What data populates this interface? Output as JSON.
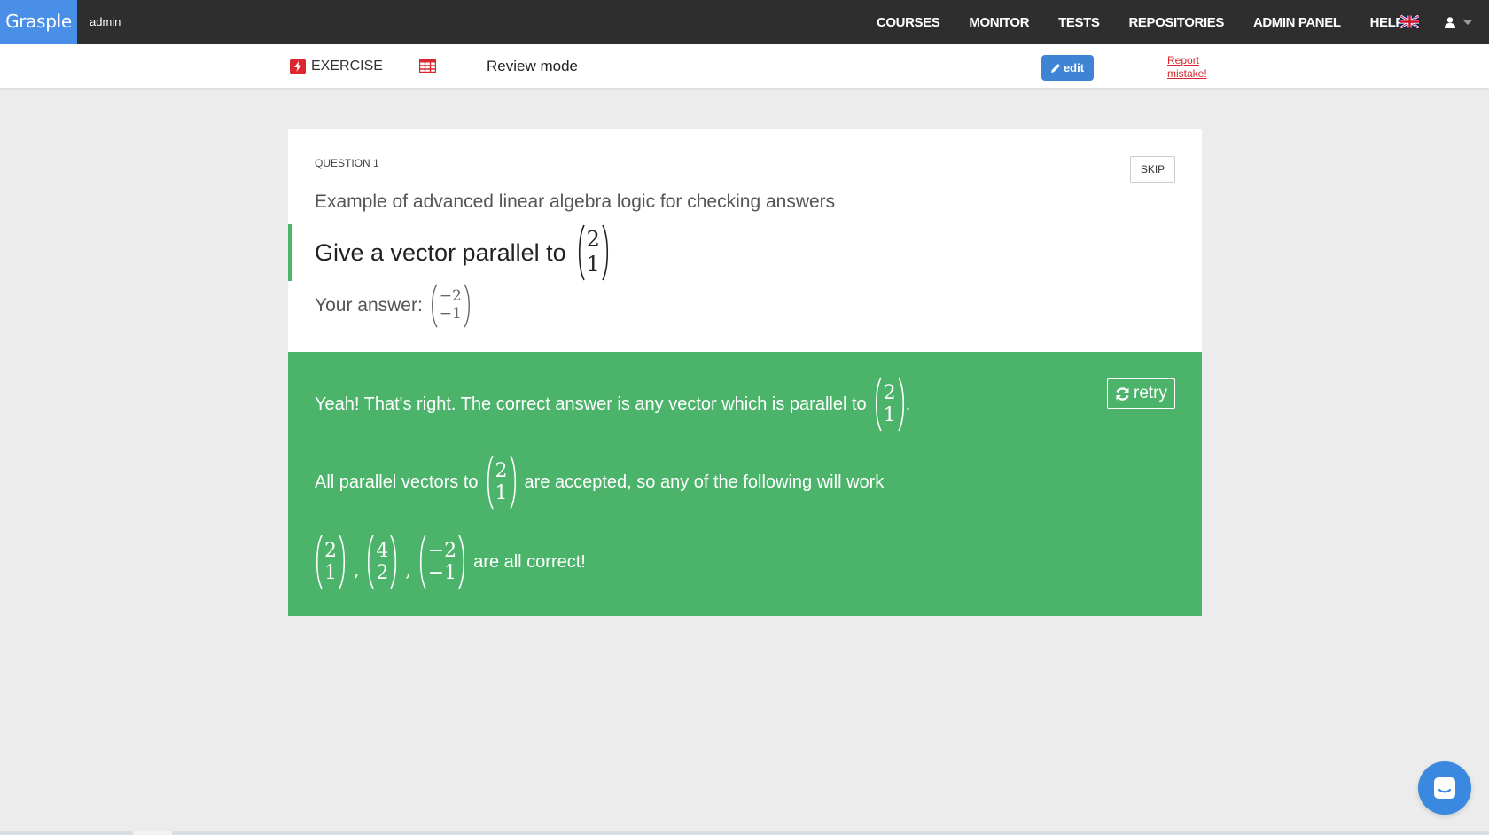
{
  "navbar": {
    "brand": "Grasple",
    "user": "admin",
    "links": [
      "COURSES",
      "MONITOR",
      "TESTS",
      "REPOSITORIES",
      "ADMIN PANEL",
      "HELP"
    ],
    "flag_icon": "uk-flag-icon",
    "user_icon": "user-icon"
  },
  "subbar": {
    "exercise_label": "EXERCISE",
    "mode": "Review mode",
    "edit_label": "edit",
    "report_label": "Report mistake!"
  },
  "question": {
    "number_label": "QUESTION 1",
    "skip_label": "SKIP",
    "title": "Example of advanced linear algebra logic for checking answers",
    "prompt_text": "Give a vector parallel to",
    "prompt_vector": [
      "2",
      "1"
    ],
    "answer_label": "Your answer:",
    "answer_vector": [
      "−2",
      "−1"
    ]
  },
  "feedback": {
    "status": "correct",
    "retry_label": "retry",
    "line1_text": "Yeah! That's right. The correct answer is any vector which is parallel to",
    "line1_vector": [
      "2",
      "1"
    ],
    "line1_end": ".",
    "line2_pre": "All parallel vectors to",
    "line2_vector": [
      "2",
      "1"
    ],
    "line2_post": "are accepted, so any of the following will work",
    "examples": [
      [
        "2",
        "1"
      ],
      [
        "4",
        "2"
      ],
      [
        "−2",
        "−1"
      ]
    ],
    "line3_post": "are all correct!"
  },
  "colors": {
    "brand": "#4a8fe7",
    "navbar": "#2e2e2e",
    "success": "#4cb36b",
    "edit": "#3f84d4",
    "report": "#d9282f",
    "chat": "#3b88e0"
  },
  "chat_icon": "chat-icon"
}
